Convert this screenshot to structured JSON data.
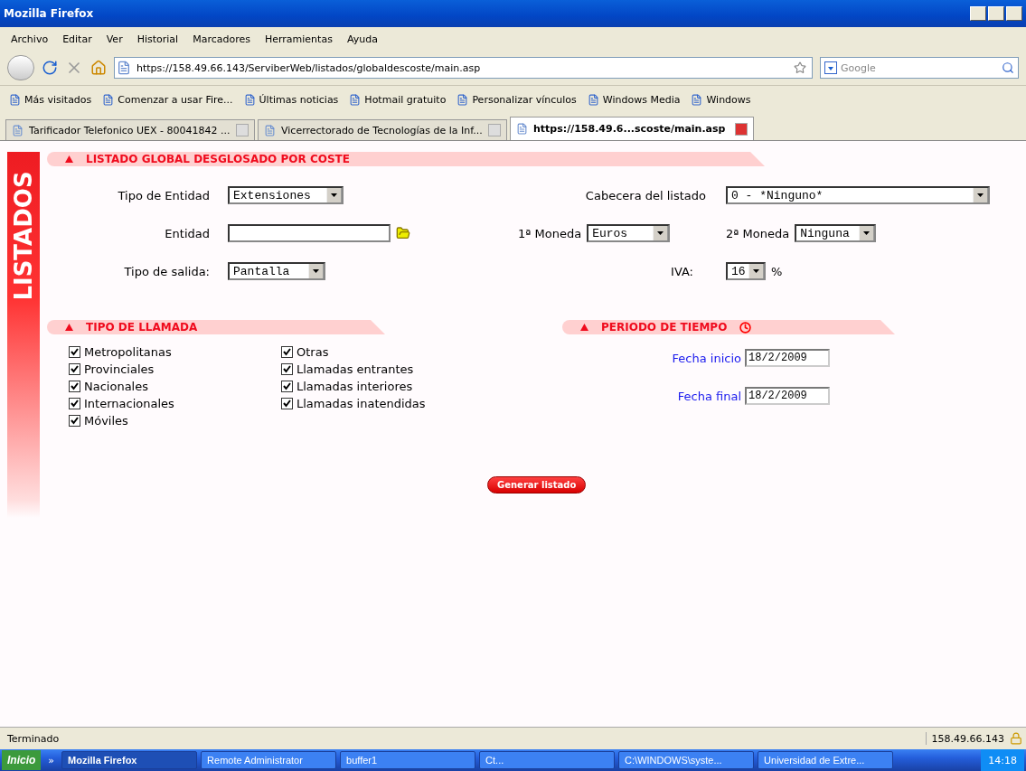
{
  "window": {
    "title": "Mozilla Firefox"
  },
  "menu": [
    "Archivo",
    "Editar",
    "Ver",
    "Historial",
    "Marcadores",
    "Herramientas",
    "Ayuda"
  ],
  "navbar": {
    "url": "https://158.49.66.143/ServiberWeb/listados/globaldescoste/main.asp",
    "search_placeholder": "Google"
  },
  "bookmarks": [
    "Más visitados",
    "Comenzar a usar Fire...",
    "Últimas noticias",
    "Hotmail gratuito",
    "Personalizar vínculos",
    "Windows Media",
    "Windows"
  ],
  "tabs": [
    {
      "label": "Tarificador Telefonico UEX - 80041842 ...",
      "selected": false
    },
    {
      "label": "Vicerrectorado de Tecnologías de la Inf...",
      "selected": false
    },
    {
      "label": "https://158.49.6...scoste/main.asp",
      "selected": true
    }
  ],
  "sidebar_label": "LISTADOS",
  "main_section": {
    "title": "LISTADO GLOBAL DESGLOSADO POR COSTE",
    "tipo_entidad": {
      "label": "Tipo de Entidad",
      "value": "Extensiones"
    },
    "cabecera": {
      "label": "Cabecera del listado",
      "value": "0 - *Ninguno*"
    },
    "entidad": {
      "label": "Entidad"
    },
    "moneda_1": {
      "label": "1ª Moneda",
      "value": "Euros"
    },
    "moneda_2": {
      "label": "2ª Moneda",
      "value": "Ninguna"
    },
    "tipo_salida": {
      "label": "Tipo de salida:",
      "value": "Pantalla"
    },
    "iva": {
      "label": "IVA:",
      "value": "16",
      "unit": "%"
    }
  },
  "call_types": {
    "title": "TIPO DE LLAMADA",
    "columns": [
      [
        {
          "label": "Metropolitanas",
          "checked": true
        },
        {
          "label": "Provinciales",
          "checked": true
        },
        {
          "label": "Nacionales",
          "checked": true
        },
        {
          "label": "Internacionales",
          "checked": true
        },
        {
          "label": "Móviles",
          "checked": true
        }
      ],
      [
        {
          "label": "Otras",
          "checked": true
        },
        {
          "label": "Llamadas entrantes",
          "checked": true
        },
        {
          "label": "Llamadas interiores",
          "checked": true
        },
        {
          "label": "Llamadas inatendidas",
          "checked": true
        }
      ]
    ]
  },
  "period": {
    "title": "PERIODO DE TIEMPO",
    "fields": [
      {
        "label": "Fecha inicio",
        "value": "18/2/2009"
      },
      {
        "label": "Fecha final",
        "value": "18/2/2009"
      }
    ]
  },
  "generate_button": "Generar listado",
  "status_bar": {
    "text": "Terminado",
    "host": "158.49.66.143"
  },
  "taskbar": {
    "start": "Inicio",
    "more": "»",
    "items": [
      {
        "label": "Mozilla Firefox",
        "selected": true
      },
      {
        "label": "Remote Administrator",
        "selected": false
      },
      {
        "label": "buffer1",
        "selected": false
      },
      {
        "label": "Ct...",
        "selected": false
      },
      {
        "label": "C:\\WINDOWS\\syste...",
        "selected": false
      },
      {
        "label": "Universidad de Extre...",
        "selected": false
      }
    ],
    "clock": "14:18"
  }
}
